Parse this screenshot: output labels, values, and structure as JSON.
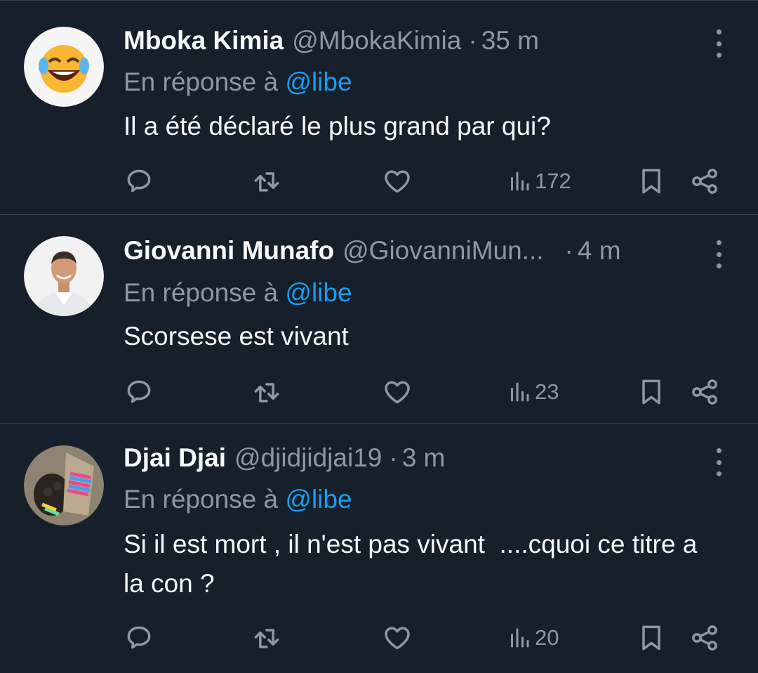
{
  "tweets": [
    {
      "display_name": "Mboka Kimia",
      "handle": "@MbokaKimia",
      "separator": "·",
      "time": "35 m",
      "reply_prefix": "En réponse à",
      "reply_mention": "@libe",
      "text": "Il a été déclaré le plus grand par qui?",
      "views": "172",
      "avatar": "laughing-emoji"
    },
    {
      "display_name": "Giovanni Munafo",
      "handle": "@GiovanniMun...",
      "separator": "·",
      "time": "4 m",
      "reply_prefix": "En réponse à",
      "reply_mention": "@libe",
      "text": "Scorsese est vivant",
      "views": "23",
      "avatar": "man-photo"
    },
    {
      "display_name": "Djai Djai",
      "handle": "@djidjidjai19",
      "separator": "·",
      "time": "3 m",
      "reply_prefix": "En réponse à",
      "reply_mention": "@libe",
      "text": "Si il est mort , il n'est pas vivant  ....cquoi ce titre a la con ?",
      "views": "20",
      "avatar": "rainbow-paw-photo"
    }
  ],
  "icons": {
    "reply": "reply-icon",
    "retweet": "retweet-icon",
    "like": "heart-icon",
    "views": "views-icon",
    "bookmark": "bookmark-icon",
    "share": "share-icon",
    "more": "more-icon"
  },
  "colors": {
    "background": "#15202b",
    "text": "#f7f9f9",
    "secondary": "#8b98a5",
    "link": "#1d9bf0",
    "divider": "#38444d"
  }
}
